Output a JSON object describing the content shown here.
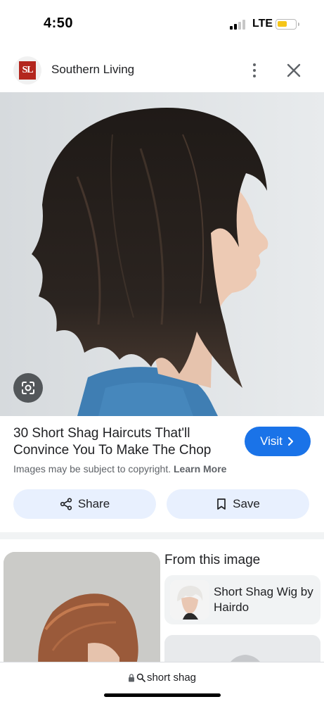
{
  "status_bar": {
    "time": "4:50",
    "network": "LTE",
    "battery_level": 0.55,
    "battery_color": "#f5c518"
  },
  "source": {
    "logo_text": "SL",
    "name": "Southern Living",
    "more_icon": "more-vert-icon",
    "close_icon": "close-icon"
  },
  "hero_image": {
    "subject": "woman with short layered dark shag haircut, profile view",
    "lens_icon": "google-lens-icon"
  },
  "result": {
    "title": "30 Short Shag Haircuts That'll Convince You To Make The Chop",
    "visit_label": "Visit",
    "visit_icon": "chevron-right-icon",
    "copyright_text": "Images may be subject to copyright.",
    "learn_more": "Learn More",
    "accent_color": "#1a73e8"
  },
  "actions": {
    "share_label": "Share",
    "share_icon": "share-icon",
    "save_label": "Save",
    "save_icon": "bookmark-icon"
  },
  "from_image": {
    "heading": "From this image",
    "products": [
      {
        "label": "Short Shag Wig by Hairdo"
      }
    ]
  },
  "url_bar": {
    "lock_icon": "lock-icon",
    "search_icon": "search-icon",
    "query": "short shag"
  }
}
